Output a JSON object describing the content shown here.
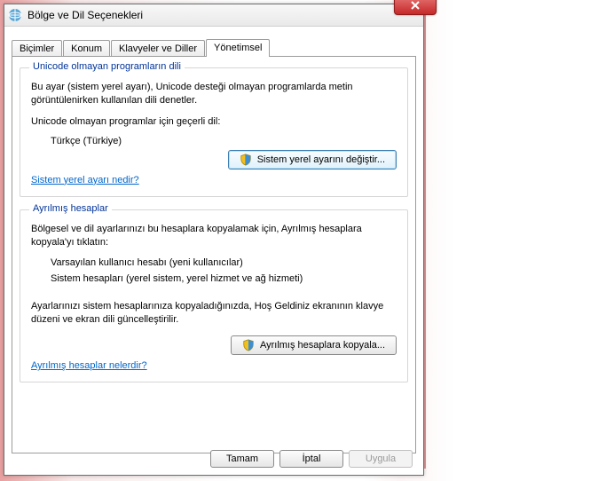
{
  "window": {
    "title": "Bölge ve Dil Seçenekleri"
  },
  "tabs": {
    "bicimler": "Biçimler",
    "konum": "Konum",
    "klavyeler": "Klavyeler ve Diller",
    "yonetimsel": "Yönetimsel"
  },
  "group1": {
    "title": "Unicode olmayan programların dili",
    "desc": "Bu ayar (sistem yerel ayarı), Unicode desteği olmayan programlarda metin görüntülenirken kullanılan dili denetler.",
    "currentLabel": "Unicode olmayan programlar için geçerli dil:",
    "currentValue": "Türkçe (Türkiye)",
    "button": "Sistem yerel ayarını değiştir...",
    "link": "Sistem yerel ayarı nedir?"
  },
  "group2": {
    "title": "Ayrılmış hesaplar",
    "desc": "Bölgesel ve dil ayarlarınızı bu hesaplara kopyalamak için, Ayrılmış hesaplara kopyala'yı tıklatın:",
    "item1": "Varsayılan kullanıcı hesabı (yeni kullanıcılar)",
    "item2": "Sistem hesapları (yerel sistem, yerel hizmet ve ağ hizmeti)",
    "note": "Ayarlarınızı sistem hesaplarınıza kopyaladığınızda, Hoş Geldiniz ekranının klavye düzeni ve ekran dili güncelleştirilir.",
    "button": "Ayrılmış hesaplara kopyala...",
    "link": "Ayrılmış hesaplar nelerdir?"
  },
  "footer": {
    "ok": "Tamam",
    "cancel": "İptal",
    "apply": "Uygula"
  }
}
